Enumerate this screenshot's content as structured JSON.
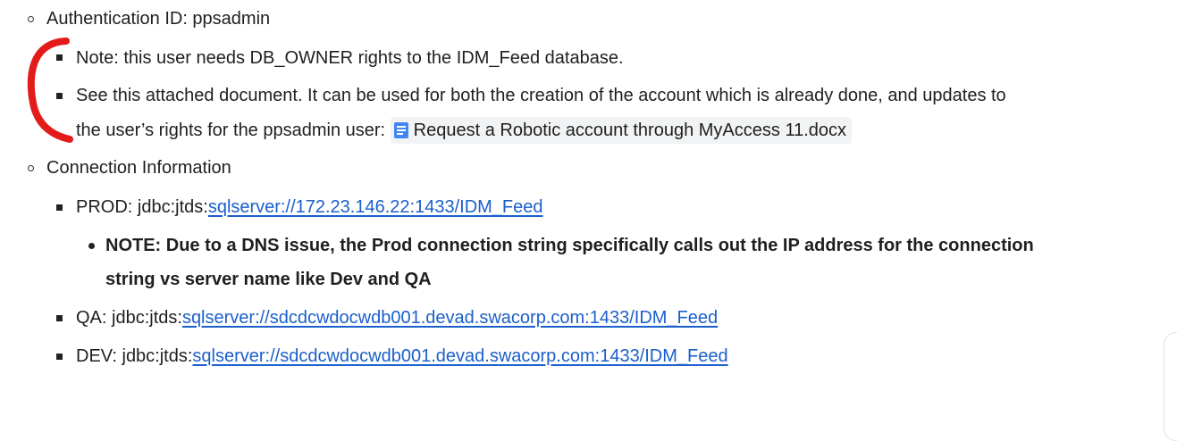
{
  "items": {
    "auth": "Authentication ID: ppsadmin",
    "note": "Note: this user needs DB_OWNER rights to the IDM_Feed database.",
    "see_line1": "See this attached document. It can be used for both the creation of the account which is already done, and updates to",
    "see_line2": "the user’s rights for the ppsadmin user:",
    "doc_chip": "Request a Robotic account through MyAccess 11.docx",
    "conn_info": "Connection Information",
    "prod_prefix": "PROD:  jdbc:jtds:",
    "prod_link": "sqlserver://172.23.146.22:1433/IDM_Feed",
    "note_bold_line1": "NOTE: Due to a DNS issue, the Prod connection string specifically calls out the IP address for the connection",
    "note_bold_line2": "string vs server name like Dev and QA",
    "qa_prefix": "QA:  jdbc:jtds:",
    "qa_link": "sqlserver://sdcdcwdocwdb001.devad.swacorp.com:1433/IDM_Feed",
    "dev_prefix": "DEV:  jdbc:jtds:",
    "dev_link": "sqlserver://sdcdcwdocwdb001.devad.swacorp.com:1433/IDM_Feed"
  },
  "icons": {
    "doc_chip_icon": "google-docs-icon",
    "annotation": "red-bracket-annotation"
  },
  "colors": {
    "link": "#1a5fcc",
    "annotation": "#e31b1b",
    "doc_icon": "#4285f4"
  }
}
